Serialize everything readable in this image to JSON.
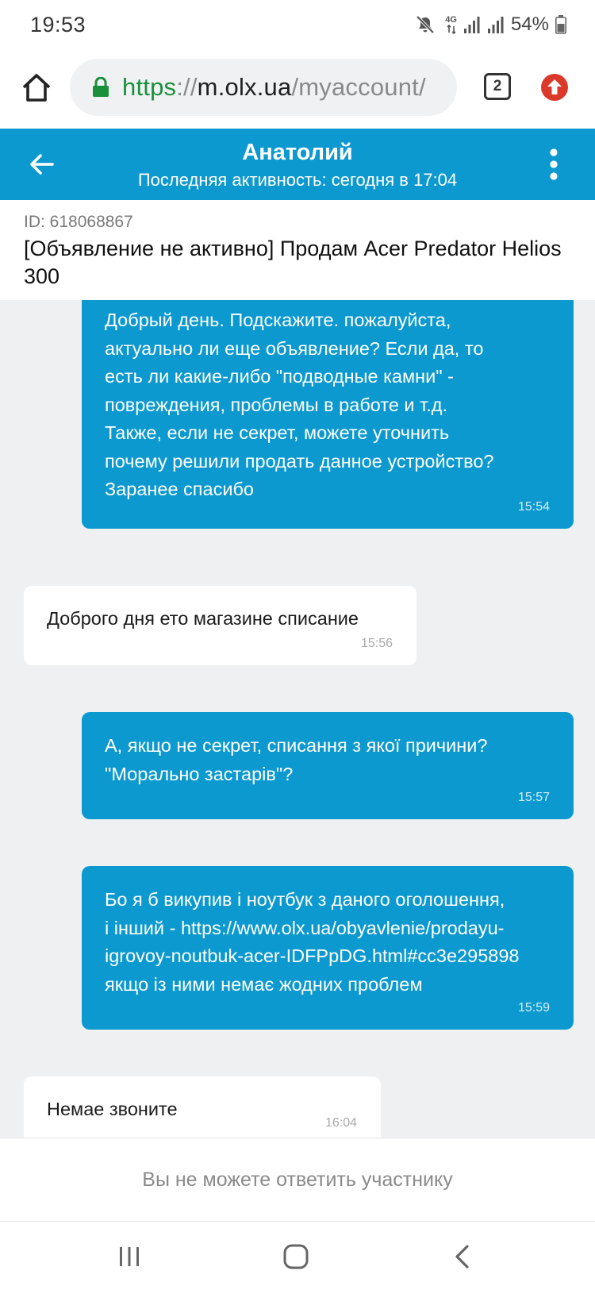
{
  "status_bar": {
    "time": "19:53",
    "network": "4G",
    "battery": "54%"
  },
  "browser": {
    "url_scheme": "https",
    "url_sep": "://",
    "url_host": "m.olx.ua",
    "url_path": "/myaccount/",
    "tab_count": "2"
  },
  "chat_header": {
    "name": "Анатолий",
    "activity": "Последняя активность: сегодня в 17:04"
  },
  "ad": {
    "id": "ID: 618068867",
    "title": "[Объявление не активно] Продам Acer Predator Helios 300"
  },
  "messages": [
    {
      "direction": "out",
      "text": "Добрый день.  Подскажите. пожалуйста,\nактуально ли еще объявление? Если да, то\nесть ли какие-либо \"подводные камни\" -\nповреждения, проблемы в работе и т.д.\nТакже, если не секрет, можете уточнить\nпочему решили продать данное устройство?\nЗаранее спасибо",
      "time": "15:54"
    },
    {
      "direction": "in",
      "text": "Доброго дня ето магазине списание",
      "time": "15:56"
    },
    {
      "direction": "out",
      "text": "А, якщо не секрет, списання з якої причини?\n\"Морально застарів\"?",
      "time": "15:57"
    },
    {
      "direction": "out",
      "text": "Бо я б викупив і ноутбук з даного оголошення,\nі інший - https://www.olx.ua/obyavlenie/prodayu-\nigrovoy-noutbuk-acer-IDFPpDG.html#cc3e295898\nякщо із ними немає жодних проблем",
      "time": "15:59"
    },
    {
      "direction": "in",
      "text": "Немае звоните",
      "time": "16:04"
    }
  ],
  "footer": {
    "reply_notice": "Вы не можете ответить участнику"
  },
  "colors": {
    "accent": "#0c99cf",
    "secure_green": "#1a8f3c",
    "update_red": "#db3a2b"
  }
}
